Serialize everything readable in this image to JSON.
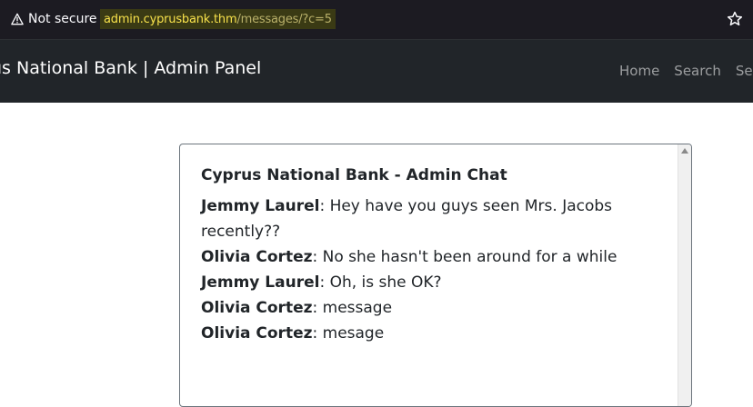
{
  "browser": {
    "security_label": "Not secure",
    "url_host": "admin.cyprusbank.thm",
    "url_path": "/messages/?c=5"
  },
  "navbar": {
    "brand": "us National Bank | Admin Panel",
    "links": [
      "Home",
      "Search",
      "Setti"
    ]
  },
  "chat": {
    "title": "Cyprus National Bank - Admin Chat",
    "messages": [
      {
        "sender": "Jemmy Laurel",
        "text": ": Hey have you guys seen Mrs. Jacobs recently??"
      },
      {
        "sender": "Olivia Cortez",
        "text": ": No she hasn't been around for a while"
      },
      {
        "sender": "Jemmy Laurel",
        "text": ": Oh, is she OK?"
      },
      {
        "sender": "Olivia Cortez",
        "text": ": message"
      },
      {
        "sender": "Olivia Cortez",
        "text": ": mesage"
      }
    ]
  },
  "colors": {
    "urlbar_bg": "#1c1b22",
    "navbar_bg": "#212529",
    "url_highlight": "#f7e14b"
  }
}
